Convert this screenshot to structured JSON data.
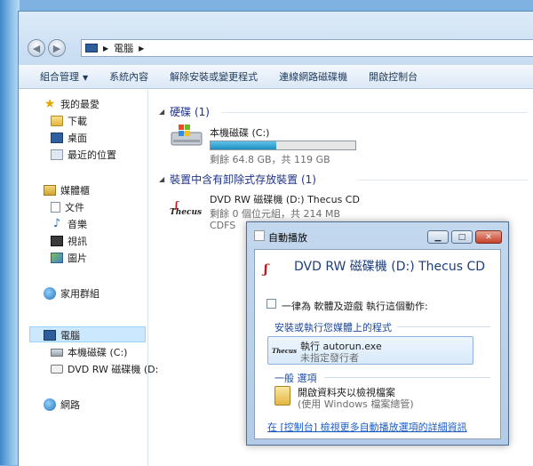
{
  "address": {
    "location": "電腦"
  },
  "toolbar": {
    "organize": "組合管理",
    "system_props": "系統內容",
    "uninstall": "解除安裝或變更程式",
    "map_drive": "連線網路磁碟機",
    "control_panel": "開啟控制台"
  },
  "nav": {
    "favorites": "我的最愛",
    "downloads": "下載",
    "desktop": "桌面",
    "recent": "最近的位置",
    "libraries": "媒體櫃",
    "documents": "文件",
    "music": "音樂",
    "videos": "視訊",
    "pictures": "圖片",
    "homegroup": "家用群組",
    "computer": "電腦",
    "local_disk": "本機磁碟 (C:)",
    "dvd_drive": "DVD RW 磁碟機 (D:",
    "network": "網路"
  },
  "content": {
    "hdd_group": "硬碟 (1)",
    "local_disk_name": "本機磁碟 (C:)",
    "local_disk_free": "剩餘 64.8 GB，共 119 GB",
    "local_disk_used_fraction": 0.455,
    "removable_group": "裝置中含有卸除式存放裝置 (1)",
    "dvd_name": "DVD RW 磁碟機 (D:) Thecus CD",
    "dvd_free": "剩餘 0 個位元組，共 214 MB",
    "dvd_fs": "CDFS",
    "thecus_logo": "Thecus"
  },
  "autoplay": {
    "title": "自動播放",
    "heading": "DVD RW 磁碟機 (D:) Thecus CD",
    "always_do": "一律為 軟體及遊戲 執行這個動作:",
    "install_section": "安裝或執行您媒體上的程式",
    "run_label": "執行 autorun.exe",
    "publisher": "未指定發行者",
    "general_section": "一般 選項",
    "open_folder": "開啟資料夾以檢視檔案",
    "open_folder_sub": "使用 Windows 檔案總管",
    "more_link": "在 [控制台] 檢視更多自動播放選項的詳細資訊",
    "thecus_logo": "Thecus"
  }
}
